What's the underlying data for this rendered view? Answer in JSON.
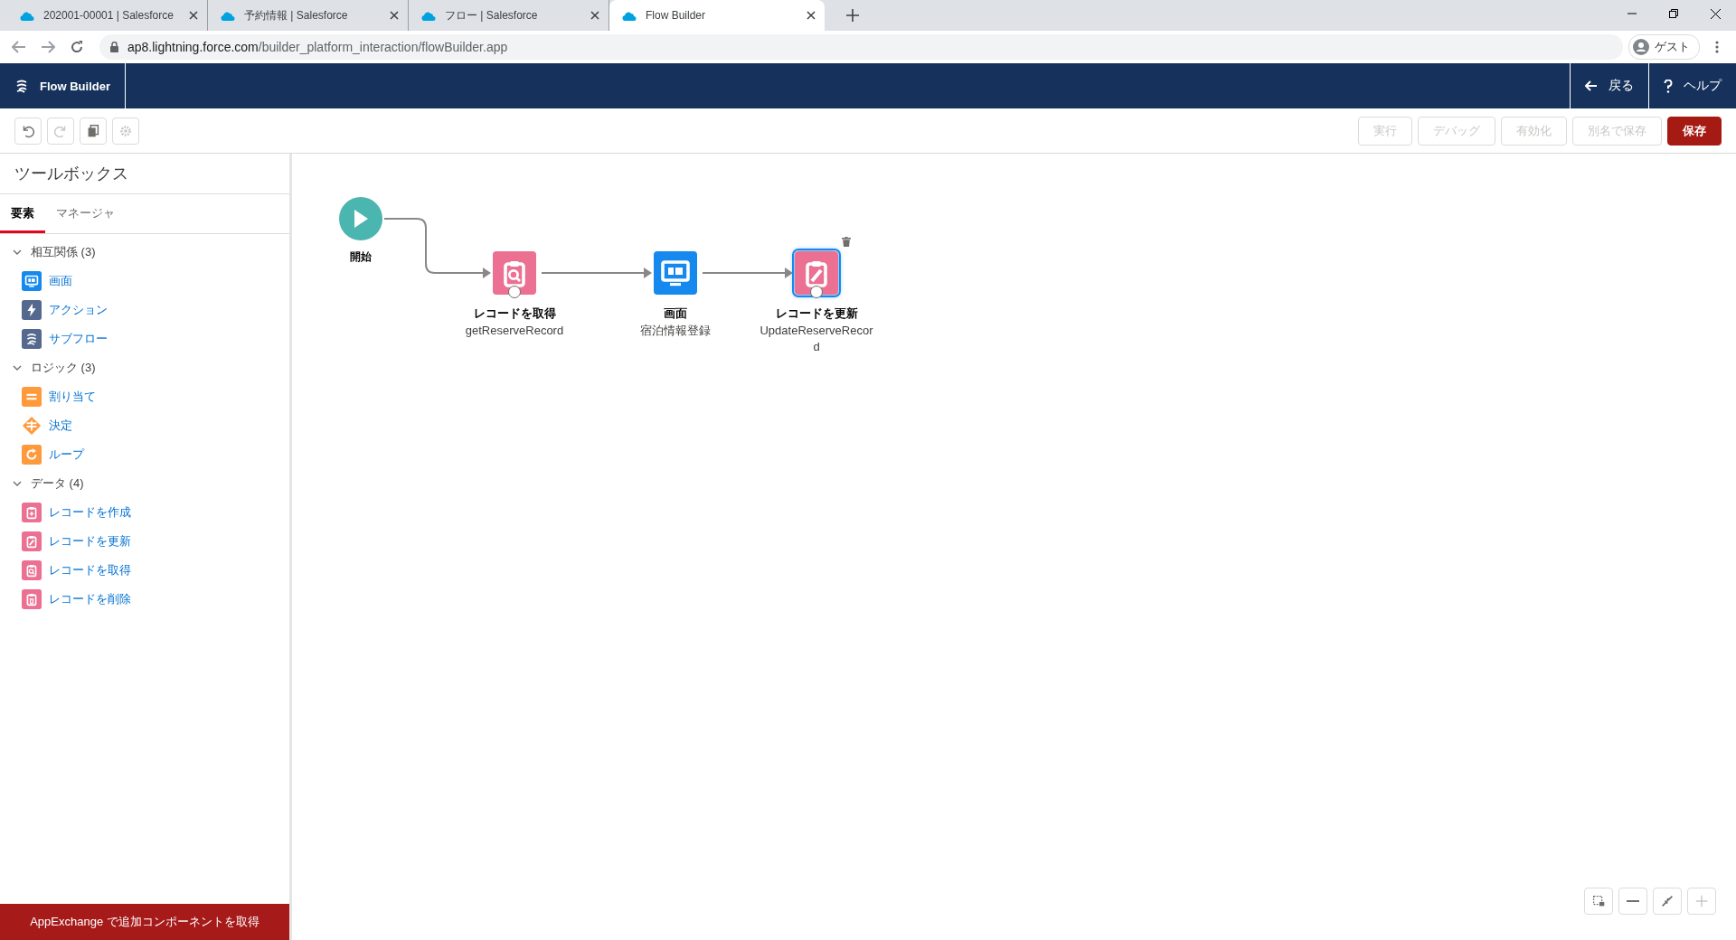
{
  "browser": {
    "tabs": [
      {
        "title": "202001-00001 | Salesforce",
        "selected": false
      },
      {
        "title": "予約情報 | Salesforce",
        "selected": false
      },
      {
        "title": "フロー | Salesforce",
        "selected": false
      },
      {
        "title": "Flow Builder",
        "selected": true
      }
    ],
    "address": {
      "host": "ap8.lightning.force.com",
      "path": "/builder_platform_interaction/flowBuilder.app"
    },
    "profile": "ゲスト"
  },
  "header": {
    "title": "Flow Builder",
    "back": "戻る",
    "help": "ヘルプ"
  },
  "toolbar": {
    "icon_buttons": [
      {
        "kind": "undo",
        "disabled": false
      },
      {
        "kind": "redo",
        "disabled": true
      },
      {
        "kind": "copy",
        "disabled": false
      },
      {
        "kind": "settings",
        "disabled": true
      }
    ],
    "buttons": [
      {
        "label": "実行",
        "kind": "neutral",
        "disabled": true
      },
      {
        "label": "デバッグ",
        "kind": "neutral",
        "disabled": true
      },
      {
        "label": "有効化",
        "kind": "neutral",
        "disabled": true
      },
      {
        "label": "別名で保存",
        "kind": "neutral",
        "disabled": true
      },
      {
        "label": "保存",
        "kind": "brand",
        "disabled": false
      }
    ]
  },
  "sidebar": {
    "title": "ツールボックス",
    "tabs": [
      {
        "label": "要素",
        "selected": true
      },
      {
        "label": "マネージャ",
        "selected": false
      }
    ],
    "sections": [
      {
        "label": "相互関係 (3)",
        "expanded": true,
        "items": [
          {
            "label": "画面",
            "kind": "screen"
          },
          {
            "label": "アクション",
            "kind": "action"
          },
          {
            "label": "サブフロー",
            "kind": "subflow"
          }
        ]
      },
      {
        "label": "ロジック (3)",
        "expanded": true,
        "items": [
          {
            "label": "割り当て",
            "kind": "assignment"
          },
          {
            "label": "決定",
            "kind": "decision"
          },
          {
            "label": "ループ",
            "kind": "loop"
          }
        ]
      },
      {
        "label": "データ (4)",
        "expanded": true,
        "items": [
          {
            "label": "レコードを作成",
            "kind": "record-create"
          },
          {
            "label": "レコードを更新",
            "kind": "record-update"
          },
          {
            "label": "レコードを取得",
            "kind": "record-lookup"
          },
          {
            "label": "レコードを削除",
            "kind": "record-delete"
          }
        ]
      }
    ],
    "footer_button": "AppExchange で追加コンポーネントを取得"
  },
  "canvas": {
    "start": {
      "label": "開始"
    },
    "nodes": [
      {
        "kind": "record-lookup",
        "title": "レコードを取得",
        "api_name": "getReserveRecord",
        "selected": false,
        "anchor": true
      },
      {
        "kind": "screen",
        "title": "画面",
        "api_name": "宿泊情報登録",
        "selected": false,
        "anchor": false
      },
      {
        "kind": "record-update",
        "title": "レコードを更新",
        "api_name": "UpdateReserveRecord",
        "selected": true,
        "anchor": true
      }
    ],
    "zoom_controls": [
      {
        "kind": "marquee",
        "disabled": false
      },
      {
        "kind": "zoom-out",
        "disabled": false
      },
      {
        "kind": "fit",
        "disabled": false
      },
      {
        "kind": "zoom-in",
        "disabled": true
      }
    ]
  }
}
